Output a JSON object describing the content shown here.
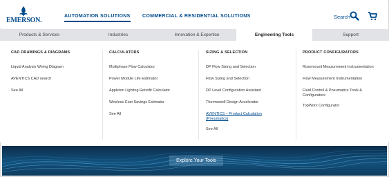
{
  "brand": {
    "logo_text": "EMERSON."
  },
  "header": {
    "tabs": [
      {
        "label": "AUTOMATION SOLUTIONS"
      },
      {
        "label": "COMMERCIAL & RESIDENTIAL SOLUTIONS"
      }
    ],
    "search_label": "Search",
    "icons": [
      "emerson-logo-icon",
      "search-icon",
      "cart-icon"
    ]
  },
  "nav": {
    "items": [
      {
        "label": "Products & Services"
      },
      {
        "label": "Industries"
      },
      {
        "label": "Innovation & Expertise"
      },
      {
        "label": "Engineering Tools"
      },
      {
        "label": "Support"
      }
    ],
    "active": "Engineering Tools"
  },
  "menu": {
    "columns": [
      {
        "heading": "CAD DRAWINGS & DIAGRAMS",
        "links": [
          "Liquid Analysis Wiring Diagram",
          "AVENTICS CAD search",
          "See All"
        ]
      },
      {
        "heading": "CALCULATORS",
        "links": [
          "Multiphase Flow Calculator",
          "Power Module Life Estimator",
          "Appleton Lighting Retrofit Calculator",
          "Wireless Cost Savings Estimator",
          "See All"
        ]
      },
      {
        "heading": "SIZING & SELECTION",
        "links": [
          "DP Flow Sizing and Selection",
          "Flow Sizing and Selection",
          "DP Level Configuration Assistant",
          "Thermowell Design Accelerator",
          "AVENTICS – Product Calculation (Pneumatics)",
          "See All"
        ]
      },
      {
        "heading": "PRODUCT CONFIGURATORS",
        "links": [
          "Rosemount Measurement Instrumentation",
          "Flow Measurement Instrumentation",
          "Fluid Control & Pneumatics Tools & Configurators",
          "TopWorx Configurator"
        ]
      }
    ]
  },
  "banner": {
    "button_label": "Explore Your Tools"
  },
  "colors": {
    "brand_blue": "#004b8d",
    "nav_bg": "#e1e3e6",
    "banner_dark": "#0c2c4a"
  }
}
